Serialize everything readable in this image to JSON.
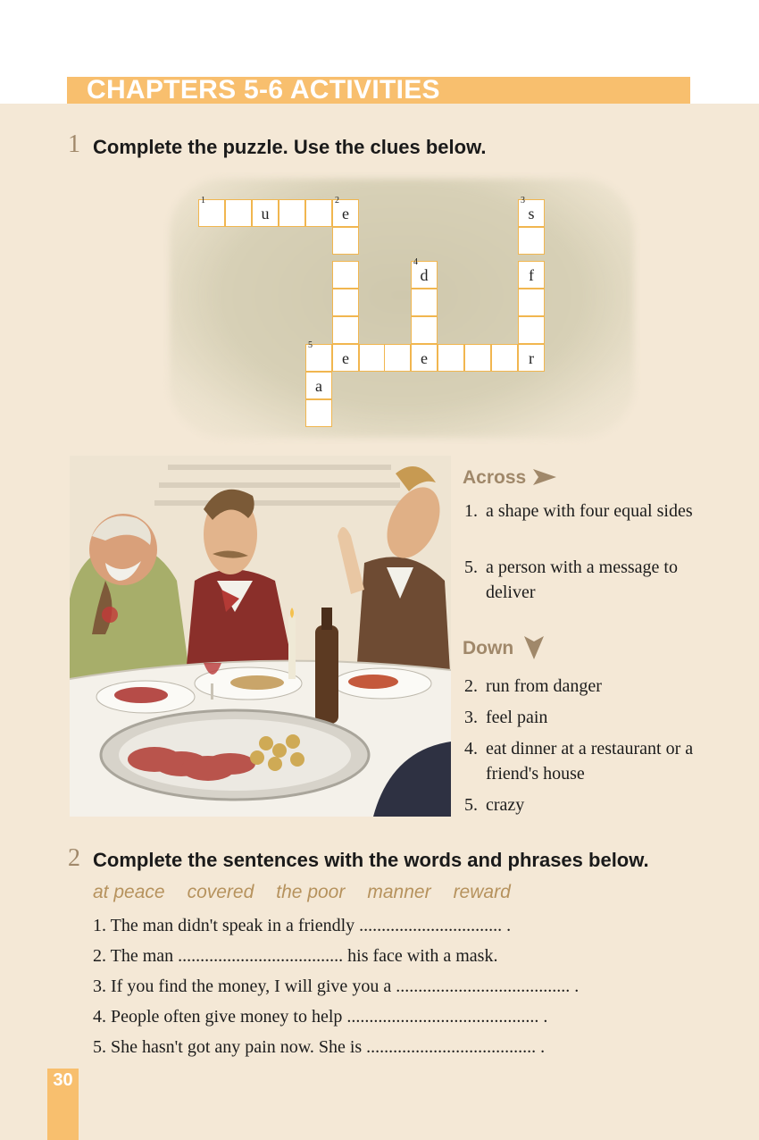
{
  "title": "CHAPTERS 5-6 ACTIVITIES",
  "exercise1": {
    "number": "1",
    "heading": "Complete the puzzle. Use the clues below."
  },
  "puzzle": {
    "cell_numbers": {
      "c1": "1",
      "c2": "2",
      "c3": "3",
      "c4": "4",
      "c5": "5"
    },
    "letters": {
      "u": "u",
      "e": "e",
      "s": "s",
      "d": "d",
      "f": "f",
      "r": "r",
      "a": "a"
    }
  },
  "clues": {
    "across_title": "Across",
    "across": [
      {
        "num": "1.",
        "text": "a shape with four equal sides"
      },
      {
        "num": "5.",
        "text": "a person with a message to deliver"
      }
    ],
    "down_title": "Down",
    "down": [
      {
        "num": "2.",
        "text": "run from danger"
      },
      {
        "num": "3.",
        "text": "feel pain"
      },
      {
        "num": "4.",
        "text": "eat dinner at a restaurant or a friend's house"
      },
      {
        "num": "5.",
        "text": "crazy"
      }
    ]
  },
  "exercise2": {
    "number": "2",
    "heading": "Complete the sentences with the words and phrases below.",
    "words": [
      "at peace",
      "covered",
      "the poor",
      "manner",
      "reward"
    ],
    "sentences": [
      "1. The man didn't speak in a friendly ................................ .",
      "2. The man ..................................... his face with a mask.",
      "3. If you find the money, I will give you a ....................................... .",
      "4. People often give money to help ........................................... .",
      "5. She hasn't got any pain now. She is ...................................... ."
    ]
  },
  "page_number": "30",
  "colors": {
    "accent": "#f8bf6e",
    "cell_border": "#f1b64f",
    "heading_muted": "#a0886a",
    "word_list": "#b6925d",
    "page_bg": "#f4e8d6"
  }
}
